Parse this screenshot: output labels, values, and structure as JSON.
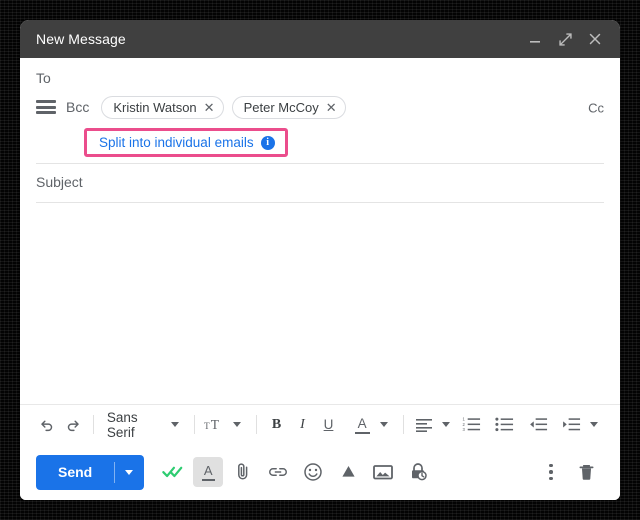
{
  "window": {
    "title": "New Message",
    "controls": [
      {
        "name": "minimize",
        "icon": "minimize-icon"
      },
      {
        "name": "expand",
        "icon": "expand-icon"
      },
      {
        "name": "close",
        "icon": "close-icon"
      }
    ]
  },
  "compose": {
    "to_label": "To",
    "bcc_label": "Bcc",
    "cc_label": "Cc",
    "recipients_icon": "recipient-list-icon",
    "recipients": [
      {
        "name": "Kristin Watson",
        "remove": "✕"
      },
      {
        "name": "Peter McCoy",
        "remove": "✕"
      }
    ],
    "split_callout": {
      "label": "Split into individual emails",
      "info_glyph": "i",
      "highlight_color": "#eb4d8c",
      "link_color": "#1a73e8"
    },
    "subject_label": "Subject",
    "body_value": ""
  },
  "format_toolbar": {
    "undo": "undo-icon",
    "redo": "redo-icon",
    "font_family": "Sans Serif",
    "font_size": "font-size-icon",
    "bold": "B",
    "italic": "I",
    "underline": "U",
    "text_color": "A",
    "align": "align-icon",
    "numbered_list": "numbered-list-icon",
    "bulleted_list": "bulleted-list-icon",
    "indent_less": "indent-decrease-icon",
    "indent_more": "indent-increase-icon",
    "more": "more-format-icon"
  },
  "bottom_bar": {
    "send_label": "Send",
    "send_color": "#1a73e8",
    "send_options": "send-options-icon",
    "grammar_check": "double-check-icon",
    "grammar_check_color": "#34c759",
    "formatting": "A",
    "attach": "attachment-icon",
    "link": "link-icon",
    "emoji": "emoji-icon",
    "drive": "drive-icon",
    "image": "image-icon",
    "confidential": "confidential-mode-icon",
    "more_options": "more-options-icon",
    "discard": "trash-icon"
  }
}
